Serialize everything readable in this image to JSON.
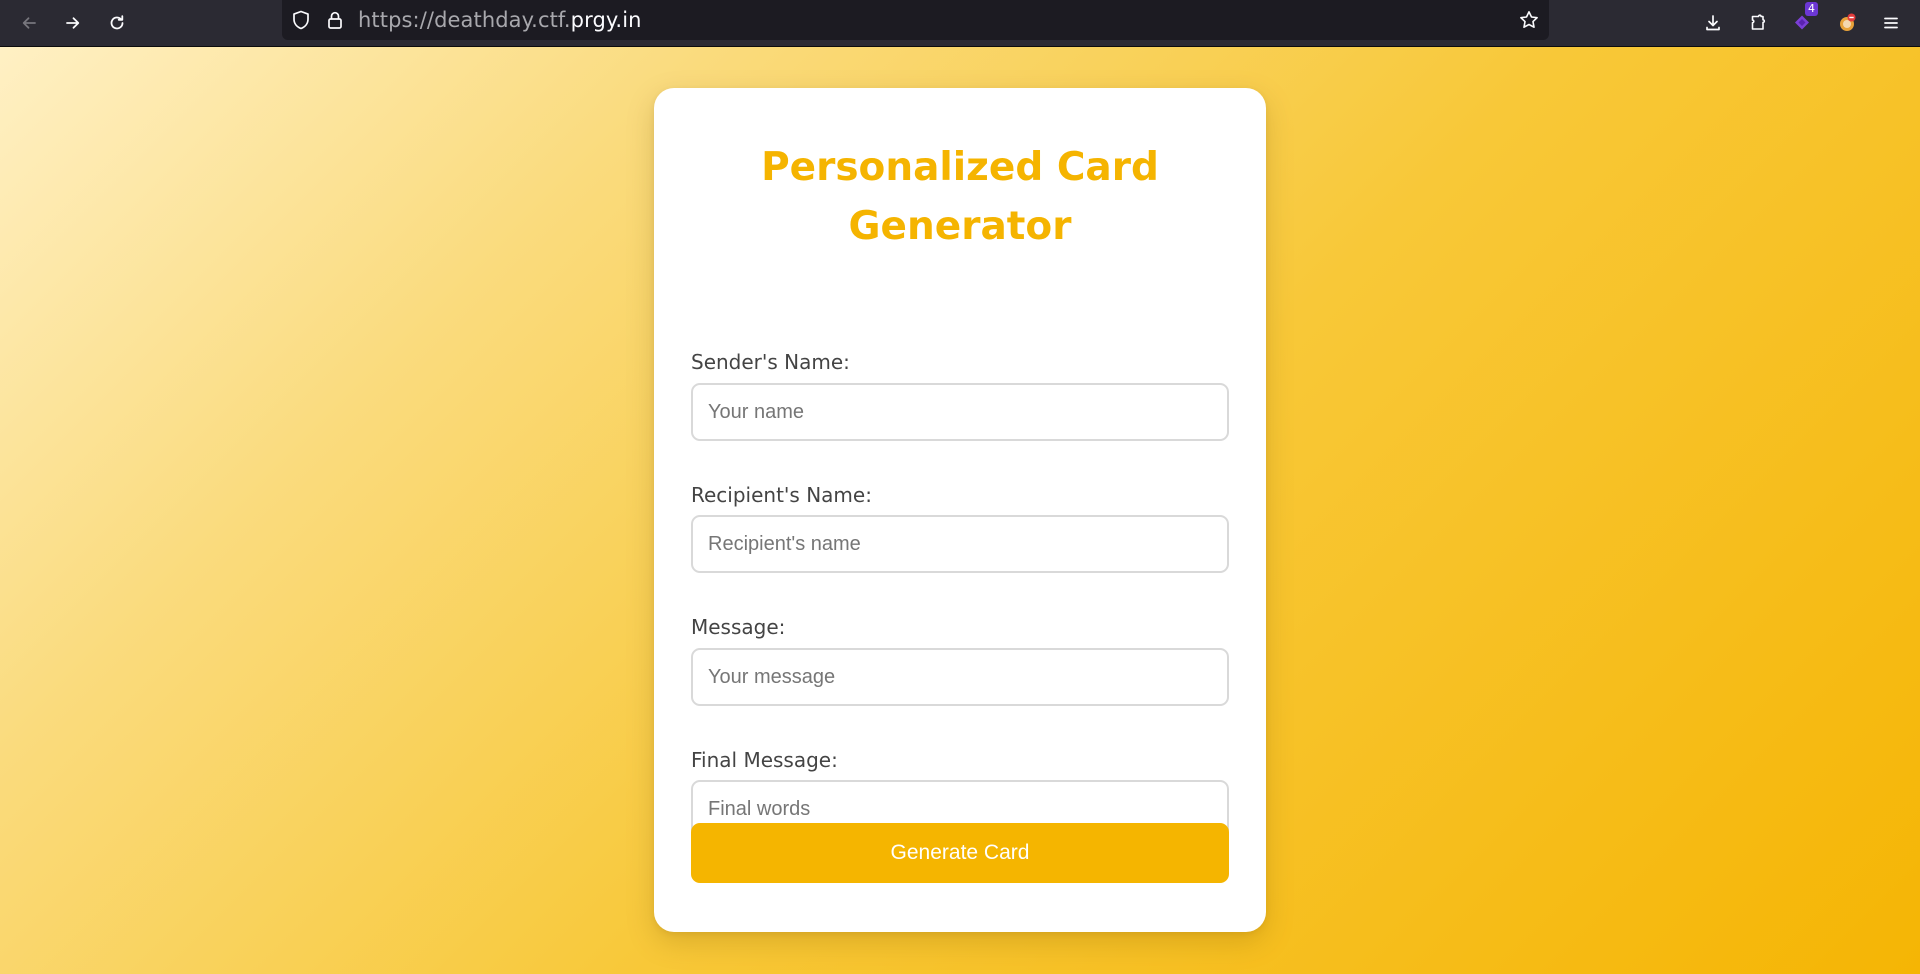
{
  "browser": {
    "url_prefix": "https://deathday.ctf.",
    "url_host": "prgy.in",
    "extension_badge_count": "4",
    "icons": [
      "back-icon",
      "forward-icon",
      "reload-icon",
      "shield-icon",
      "lock-icon",
      "star-icon",
      "download-icon",
      "extensions-icon",
      "extension-icon",
      "account-icon",
      "menu-icon"
    ]
  },
  "form": {
    "title": "Personalized Card Generator",
    "fields": [
      {
        "label": "Sender's Name:",
        "placeholder": "Your name",
        "value": ""
      },
      {
        "label": "Recipient's Name:",
        "placeholder": "Recipient's name",
        "value": ""
      },
      {
        "label": "Message:",
        "placeholder": "Your message",
        "value": ""
      },
      {
        "label": "Final Message:",
        "placeholder": "Final words",
        "value": ""
      }
    ],
    "submit_label": "Generate Card"
  },
  "colors": {
    "accent": "#f5b500",
    "title": "#f5b400",
    "background_start": "#fff0c4",
    "background_end": "#f5b504"
  }
}
